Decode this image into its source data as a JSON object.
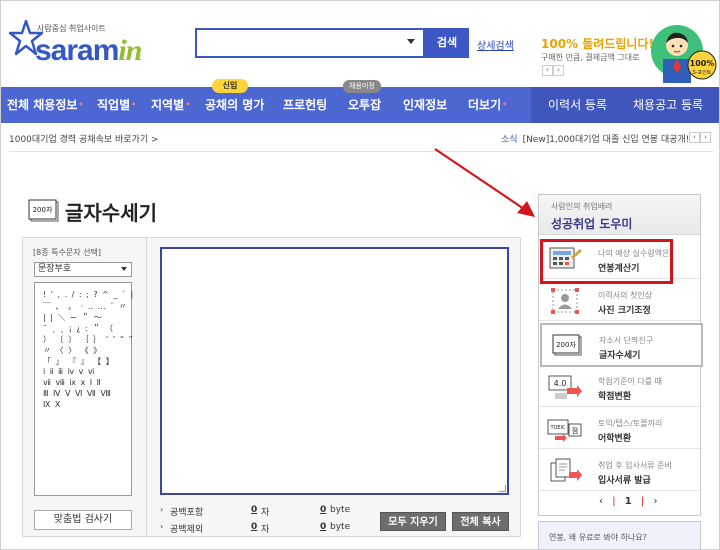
{
  "header": {
    "logo_tagline": "사람중심 취업사이트",
    "logo_main": "saram",
    "logo_accent": "in",
    "search_placeholder": "",
    "search_button": "검색",
    "detail_search_link": "상세검색",
    "promo_title": "100% 돌려드립니다!",
    "promo_subtitle": "구매한 만큼, 결제금액 그대로",
    "mascot_badge": "100%",
    "mascot_badge_sub": "S-포인트"
  },
  "nav": {
    "items": [
      {
        "label": "전체 채용정보",
        "has_dot": true
      },
      {
        "label": "직업별",
        "has_dot": true
      },
      {
        "label": "지역별",
        "has_dot": true
      },
      {
        "label": "공채의 명가",
        "has_dot": false
      },
      {
        "label": "프로헌팅",
        "has_dot": false
      },
      {
        "label": "오투잡",
        "has_dot": false
      },
      {
        "label": "인재정보",
        "has_dot": false
      },
      {
        "label": "더보기",
        "has_dot": true
      }
    ],
    "right_items": [
      "이력서 등록",
      "채용공고 등록"
    ],
    "badge_new": "신입",
    "badge_re": "채용미정"
  },
  "ticker": {
    "left_text": "1000대기업 경력 공채속보 바로가기 >",
    "news_label": "소식",
    "news_text": "[New]1,000대기업 대졸 신입 연봉 대공개!",
    "arrow_prev": "‹",
    "arrow_next": "›"
  },
  "tool": {
    "icon_text": "200자",
    "title": "글자수세기",
    "special_label": "[8종 특수문자 선택]",
    "special_selected": "문장부호",
    "char_rows": [
      "! ' , . / : ; ? ^ _ ` |",
      "￣ 、 。 · ‥ … ¨ 〃",
      "| | ＼ ∼ ＂ ～",
      "˘ ¸ ˛ ¡ ¿ ː ＂ （",
      "） 〔 〕 ｛ ｝ ‘ ’ “ ”",
      "〃 〈 〉 《 》",
      "「 」 『 』 【 】",
      "ⅰ ⅱ ⅲ ⅳ ⅴ ⅵ",
      "ⅶ ⅷ ⅸ ⅹ Ⅰ Ⅱ",
      "Ⅲ Ⅳ Ⅴ Ⅵ Ⅶ Ⅷ",
      "Ⅸ Ⅹ"
    ],
    "spell_check_button": "맞춤법 검사기",
    "stats": [
      {
        "label": "공백포함",
        "chars": "0",
        "chars_unit": "자",
        "bytes": "0",
        "bytes_unit": "byte"
      },
      {
        "label": "공백제외",
        "chars": "0",
        "chars_unit": "자",
        "bytes": "0",
        "bytes_unit": "byte"
      }
    ],
    "clear_button": "모두 지우기",
    "copy_button": "전체 복사"
  },
  "sidebar": {
    "header_sub": "사람인의 취업배려",
    "header_title": "성공취업 도우미",
    "items": [
      {
        "line1": "나의 예상 실수령액은?",
        "line2": "연봉계산기",
        "icon": "calculator-icon"
      },
      {
        "line1": "이력서의 첫인상",
        "line2": "사진 크기조정",
        "icon": "photo-resize-icon"
      },
      {
        "line1": "자소서 단짝친구",
        "line2": "글자수세기",
        "icon": "character-count-icon",
        "icon_text": "200자"
      },
      {
        "line1": "학점기준이 다를 때",
        "line2": "학점변환",
        "icon": "grade-convert-icon",
        "icon_text": "4.0"
      },
      {
        "line1": "토익/텝스/토플끼리",
        "line2": "어학변환",
        "icon": "language-convert-icon",
        "icon_text": "TOEIC",
        "icon_text2": "점"
      },
      {
        "line1": "취업 후 입사서류 준비",
        "line2": "입사서류 발급",
        "icon": "document-issue-icon"
      }
    ],
    "pager_prev": "‹",
    "pager_current": "1",
    "pager_next": "›",
    "bottom_text": "연봉, 왜 유료로 봐야 하나요?"
  },
  "colors": {
    "brand_blue": "#4c67d1",
    "highlight_red": "#d4141b",
    "promo_gold": "#e7a400",
    "logo_green": "#8fbe2f"
  }
}
